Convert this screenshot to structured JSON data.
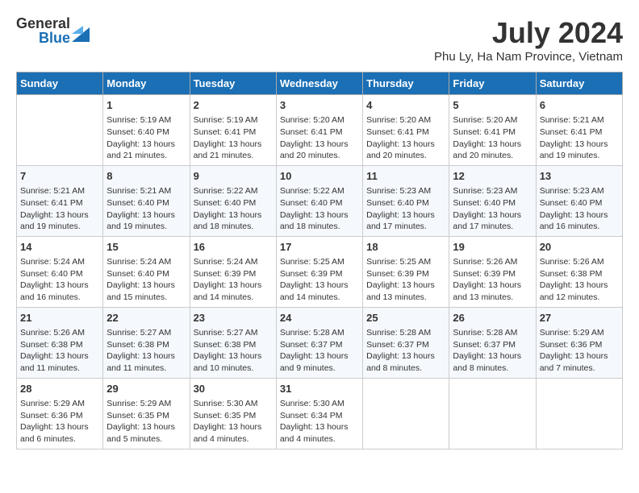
{
  "header": {
    "logo_general": "General",
    "logo_blue": "Blue",
    "month_year": "July 2024",
    "location": "Phu Ly, Ha Nam Province, Vietnam"
  },
  "weekdays": [
    "Sunday",
    "Monday",
    "Tuesday",
    "Wednesday",
    "Thursday",
    "Friday",
    "Saturday"
  ],
  "weeks": [
    [
      {
        "day": "",
        "info": ""
      },
      {
        "day": "1",
        "info": "Sunrise: 5:19 AM\nSunset: 6:40 PM\nDaylight: 13 hours\nand 21 minutes."
      },
      {
        "day": "2",
        "info": "Sunrise: 5:19 AM\nSunset: 6:41 PM\nDaylight: 13 hours\nand 21 minutes."
      },
      {
        "day": "3",
        "info": "Sunrise: 5:20 AM\nSunset: 6:41 PM\nDaylight: 13 hours\nand 20 minutes."
      },
      {
        "day": "4",
        "info": "Sunrise: 5:20 AM\nSunset: 6:41 PM\nDaylight: 13 hours\nand 20 minutes."
      },
      {
        "day": "5",
        "info": "Sunrise: 5:20 AM\nSunset: 6:41 PM\nDaylight: 13 hours\nand 20 minutes."
      },
      {
        "day": "6",
        "info": "Sunrise: 5:21 AM\nSunset: 6:41 PM\nDaylight: 13 hours\nand 19 minutes."
      }
    ],
    [
      {
        "day": "7",
        "info": "Sunrise: 5:21 AM\nSunset: 6:41 PM\nDaylight: 13 hours\nand 19 minutes."
      },
      {
        "day": "8",
        "info": "Sunrise: 5:21 AM\nSunset: 6:40 PM\nDaylight: 13 hours\nand 19 minutes."
      },
      {
        "day": "9",
        "info": "Sunrise: 5:22 AM\nSunset: 6:40 PM\nDaylight: 13 hours\nand 18 minutes."
      },
      {
        "day": "10",
        "info": "Sunrise: 5:22 AM\nSunset: 6:40 PM\nDaylight: 13 hours\nand 18 minutes."
      },
      {
        "day": "11",
        "info": "Sunrise: 5:23 AM\nSunset: 6:40 PM\nDaylight: 13 hours\nand 17 minutes."
      },
      {
        "day": "12",
        "info": "Sunrise: 5:23 AM\nSunset: 6:40 PM\nDaylight: 13 hours\nand 17 minutes."
      },
      {
        "day": "13",
        "info": "Sunrise: 5:23 AM\nSunset: 6:40 PM\nDaylight: 13 hours\nand 16 minutes."
      }
    ],
    [
      {
        "day": "14",
        "info": "Sunrise: 5:24 AM\nSunset: 6:40 PM\nDaylight: 13 hours\nand 16 minutes."
      },
      {
        "day": "15",
        "info": "Sunrise: 5:24 AM\nSunset: 6:40 PM\nDaylight: 13 hours\nand 15 minutes."
      },
      {
        "day": "16",
        "info": "Sunrise: 5:24 AM\nSunset: 6:39 PM\nDaylight: 13 hours\nand 14 minutes."
      },
      {
        "day": "17",
        "info": "Sunrise: 5:25 AM\nSunset: 6:39 PM\nDaylight: 13 hours\nand 14 minutes."
      },
      {
        "day": "18",
        "info": "Sunrise: 5:25 AM\nSunset: 6:39 PM\nDaylight: 13 hours\nand 13 minutes."
      },
      {
        "day": "19",
        "info": "Sunrise: 5:26 AM\nSunset: 6:39 PM\nDaylight: 13 hours\nand 13 minutes."
      },
      {
        "day": "20",
        "info": "Sunrise: 5:26 AM\nSunset: 6:38 PM\nDaylight: 13 hours\nand 12 minutes."
      }
    ],
    [
      {
        "day": "21",
        "info": "Sunrise: 5:26 AM\nSunset: 6:38 PM\nDaylight: 13 hours\nand 11 minutes."
      },
      {
        "day": "22",
        "info": "Sunrise: 5:27 AM\nSunset: 6:38 PM\nDaylight: 13 hours\nand 11 minutes."
      },
      {
        "day": "23",
        "info": "Sunrise: 5:27 AM\nSunset: 6:38 PM\nDaylight: 13 hours\nand 10 minutes."
      },
      {
        "day": "24",
        "info": "Sunrise: 5:28 AM\nSunset: 6:37 PM\nDaylight: 13 hours\nand 9 minutes."
      },
      {
        "day": "25",
        "info": "Sunrise: 5:28 AM\nSunset: 6:37 PM\nDaylight: 13 hours\nand 8 minutes."
      },
      {
        "day": "26",
        "info": "Sunrise: 5:28 AM\nSunset: 6:37 PM\nDaylight: 13 hours\nand 8 minutes."
      },
      {
        "day": "27",
        "info": "Sunrise: 5:29 AM\nSunset: 6:36 PM\nDaylight: 13 hours\nand 7 minutes."
      }
    ],
    [
      {
        "day": "28",
        "info": "Sunrise: 5:29 AM\nSunset: 6:36 PM\nDaylight: 13 hours\nand 6 minutes."
      },
      {
        "day": "29",
        "info": "Sunrise: 5:29 AM\nSunset: 6:35 PM\nDaylight: 13 hours\nand 5 minutes."
      },
      {
        "day": "30",
        "info": "Sunrise: 5:30 AM\nSunset: 6:35 PM\nDaylight: 13 hours\nand 4 minutes."
      },
      {
        "day": "31",
        "info": "Sunrise: 5:30 AM\nSunset: 6:34 PM\nDaylight: 13 hours\nand 4 minutes."
      },
      {
        "day": "",
        "info": ""
      },
      {
        "day": "",
        "info": ""
      },
      {
        "day": "",
        "info": ""
      }
    ]
  ]
}
